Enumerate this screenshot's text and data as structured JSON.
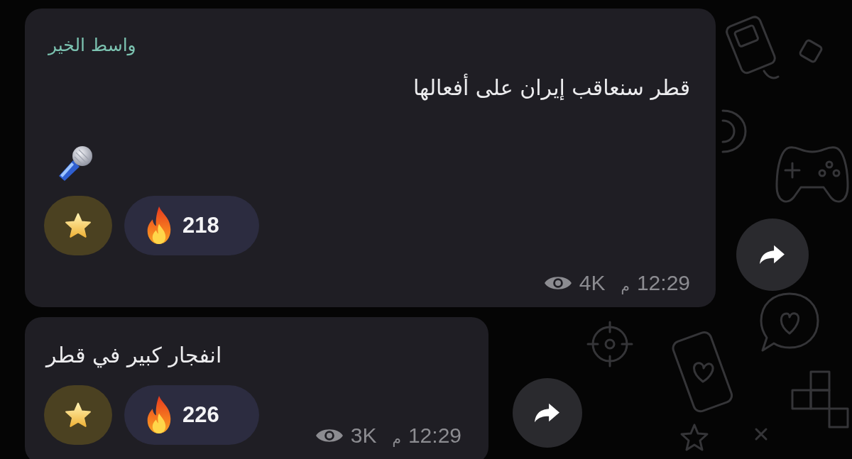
{
  "messages": [
    {
      "sender": "واسط الخير",
      "body": [
        {
          "kind": "text",
          "text": "قطر سنعاقب إيران على أفعالها"
        },
        {
          "kind": "mic"
        }
      ],
      "reactions": [
        {
          "kind": "star"
        },
        {
          "kind": "fire",
          "count": "218"
        }
      ],
      "views": "4K",
      "meridiem": "م",
      "time": "12:29"
    },
    {
      "body": [
        {
          "kind": "text",
          "text": "انفجار كبير في قطر"
        }
      ],
      "reactions": [
        {
          "kind": "star"
        },
        {
          "kind": "fire",
          "count": "226"
        }
      ],
      "views": "3K",
      "meridiem": "م",
      "time": "12:29"
    }
  ]
}
